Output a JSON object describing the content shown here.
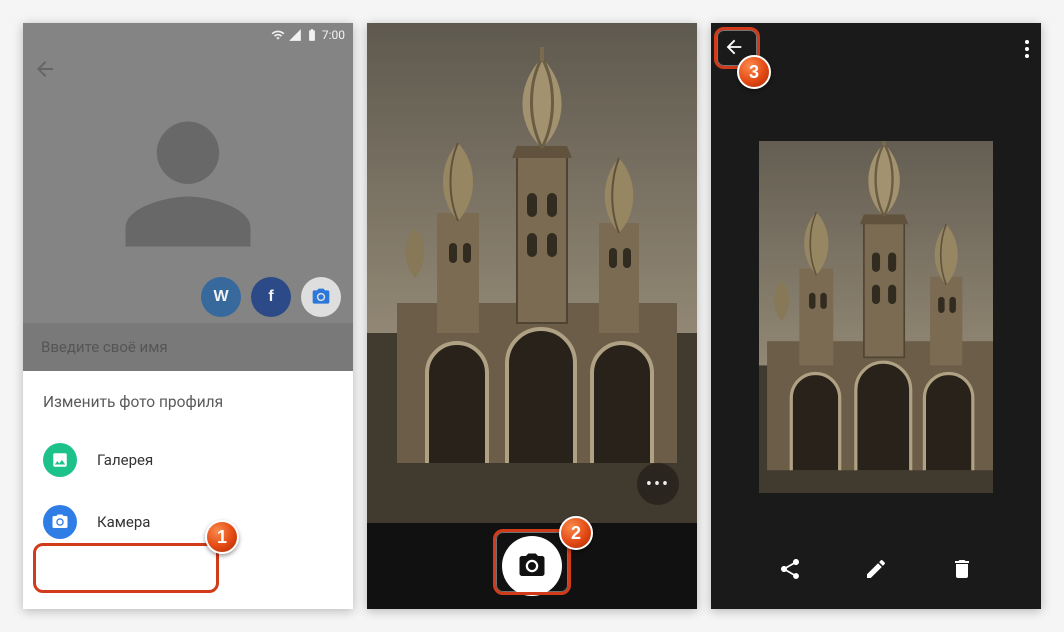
{
  "statusbar": {
    "time": "7:00"
  },
  "screen1": {
    "name_placeholder": "Введите своё имя",
    "sheet_title": "Изменить фото профиля",
    "options": {
      "gallery": "Галерея",
      "camera": "Камера"
    },
    "social": {
      "vk": "W",
      "fb": "f"
    }
  },
  "badges": {
    "b1": "1",
    "b2": "2",
    "b3": "3"
  }
}
